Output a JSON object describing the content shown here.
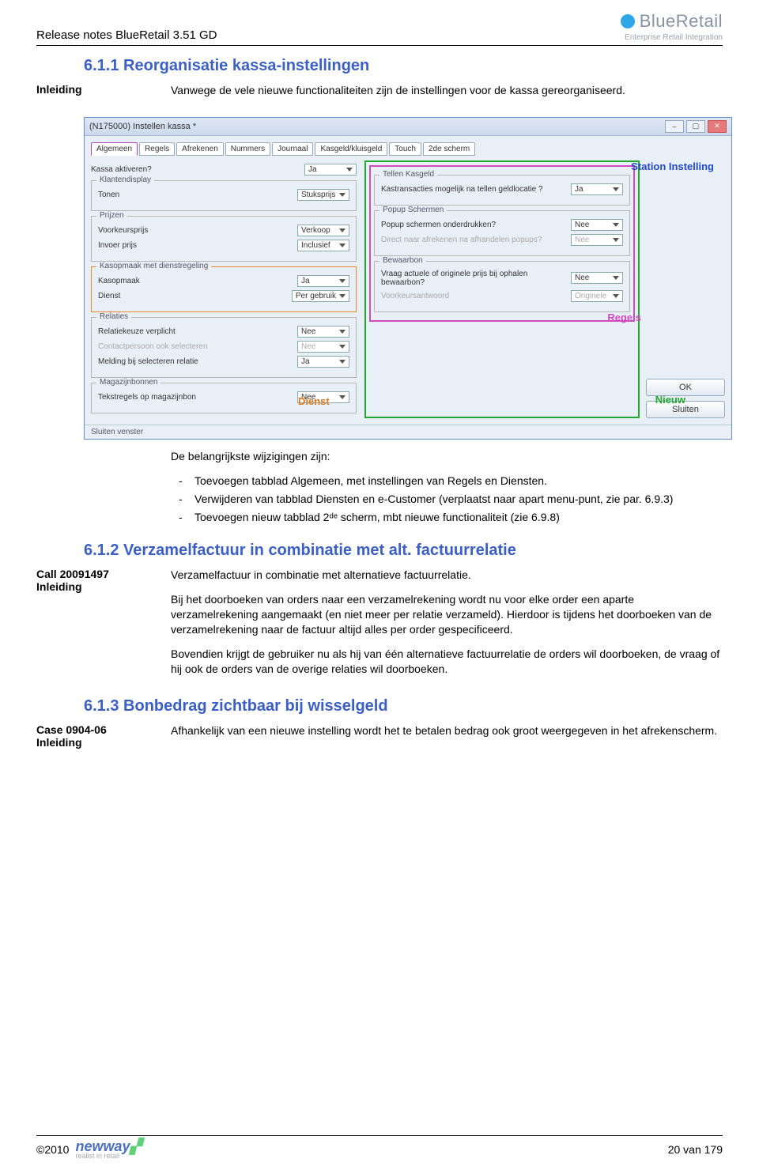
{
  "header": {
    "title": "Release notes BlueRetail 3.51 GD",
    "logo_name": "BlueRetail",
    "logo_sub": "Enterprise Retail Integration"
  },
  "section_611": {
    "number_title": "6.1.1 Reorganisatie kassa-instellingen",
    "label": "Inleiding",
    "intro": "Vanwege de vele nieuwe functionaliteiten zijn de instellingen voor de kassa gereorganiseerd."
  },
  "screenshot": {
    "window_title": "(N175000) Instellen kassa *",
    "tabs": [
      "Algemeen",
      "Regels",
      "Afrekenen",
      "Nummers",
      "Journaal",
      "Kasgeld/kluisgeld",
      "Touch",
      "2de scherm"
    ],
    "annotations": {
      "station": "Station Instelling",
      "nieuw": "Nieuw",
      "dienst": "Dienst",
      "regels": "Regels"
    },
    "buttons": {
      "ok": "OK",
      "sluiten": "Sluiten"
    },
    "statusbar": "Sluiten venster",
    "left": {
      "kassa": {
        "title": "",
        "lab": "Kassa aktiveren?",
        "val": "Ja"
      },
      "klant": {
        "title": "Klantendisplay",
        "lab": "Tonen",
        "val": "Stuksprijs"
      },
      "prijzen": {
        "title": "Prijzen",
        "l1": "Voorkeursprijs",
        "v1": "Verkoop",
        "l2": "Invoer prijs",
        "v2": "Inclusief"
      },
      "kasop": {
        "title": "Kasopmaak met dienstregeling",
        "l1": "Kasopmaak",
        "v1": "Ja",
        "l2": "Dienst",
        "v2": "Per gebruik"
      },
      "relaties": {
        "title": "Relaties",
        "l1": "Relatiekeuze verplicht",
        "v1": "Nee",
        "l2": "Contactpersoon ook selecteren",
        "v2": "Nee",
        "l3": "Melding bij selecteren relatie",
        "v3": "Ja"
      },
      "magazijn": {
        "title": "Magazijnbonnen",
        "l1": "Tekstregels op magazijnbon",
        "v1": "Nee"
      }
    },
    "right": {
      "tellen": {
        "title": "Tellen Kasgeld",
        "l1": "Kastransacties mogelijk na tellen geldlocatie ?",
        "v1": "Ja"
      },
      "popup": {
        "title": "Popup Schermen",
        "l1": "Popup schermen onderdrukken?",
        "v1": "Nee",
        "l2": "Direct naar afrekenen na afhandelen popups?",
        "v2": "Nee"
      },
      "bewaar": {
        "title": "Bewaarbon",
        "l1": "Vraag actuele of originele prijs bij ophalen bewaarbon?",
        "v1": "Nee",
        "l2": "Voorkeursantwoord",
        "v2": "Originele"
      }
    }
  },
  "changes": {
    "intro": "De belangrijkste wijzigingen zijn:",
    "items": [
      "Toevoegen tabblad Algemeen, met instellingen van Regels en Diensten.",
      "Verwijderen van tabblad Diensten en e-Customer (verplaatst naar apart menu-punt, zie par. 6.9.3)",
      "Toevoegen nieuw tabblad 2ᵈᵉ scherm, mbt nieuwe functionaliteit (zie 6.9.8)"
    ]
  },
  "section_612": {
    "number_title": "6.1.2 Verzamelfactuur in combinatie met alt. factuurrelatie",
    "call": "Call 20091497",
    "label": "Inleiding",
    "p1": "Verzamelfactuur in combinatie met alternatieve factuurrelatie.",
    "p2": "Bij het doorboeken van orders naar een verzamelrekening wordt nu voor elke order een aparte verzamelrekening aangemaakt (en niet meer per relatie verzameld). Hierdoor is tijdens het doorboeken van de verzamelrekening naar de factuur altijd alles per order gespecificeerd.",
    "p3": "Bovendien krijgt de gebruiker nu als hij van één alternatieve factuurrelatie de orders wil doorboeken, de vraag of hij ook de orders van de overige relaties wil doorboeken."
  },
  "section_613": {
    "number_title": "6.1.3 Bonbedrag zichtbaar bij wisselgeld",
    "case": "Case 0904-06",
    "label": "Inleiding",
    "p1": "Afhankelijk van een nieuwe instelling wordt het te betalen bedrag ook groot weergegeven in het afrekenscherm."
  },
  "footer": {
    "copyright": "©2010",
    "logo": "newway",
    "logo_sub": "realist in retail",
    "page": "20 van 179"
  }
}
